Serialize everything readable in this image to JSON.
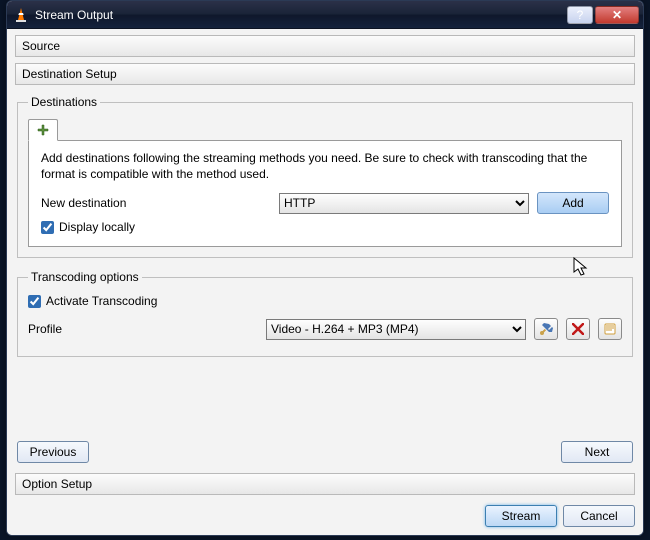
{
  "window": {
    "title": "Stream Output"
  },
  "sections": {
    "source": "Source",
    "destination_setup": "Destination Setup",
    "option_setup": "Option Setup"
  },
  "destinations": {
    "legend": "Destinations",
    "help": "Add destinations following the streaming methods you need. Be sure to check with transcoding that the format is compatible with the method used.",
    "new_destination_label": "New destination",
    "combo_value": "HTTP",
    "add_label": "Add",
    "display_locally_label": "Display locally",
    "display_locally_checked": true
  },
  "transcoding": {
    "legend": "Transcoding options",
    "activate_label": "Activate Transcoding",
    "activate_checked": true,
    "profile_label": "Profile",
    "profile_value": "Video - H.264 + MP3 (MP4)"
  },
  "nav": {
    "previous": "Previous",
    "next": "Next"
  },
  "footer": {
    "stream": "Stream",
    "cancel": "Cancel"
  }
}
